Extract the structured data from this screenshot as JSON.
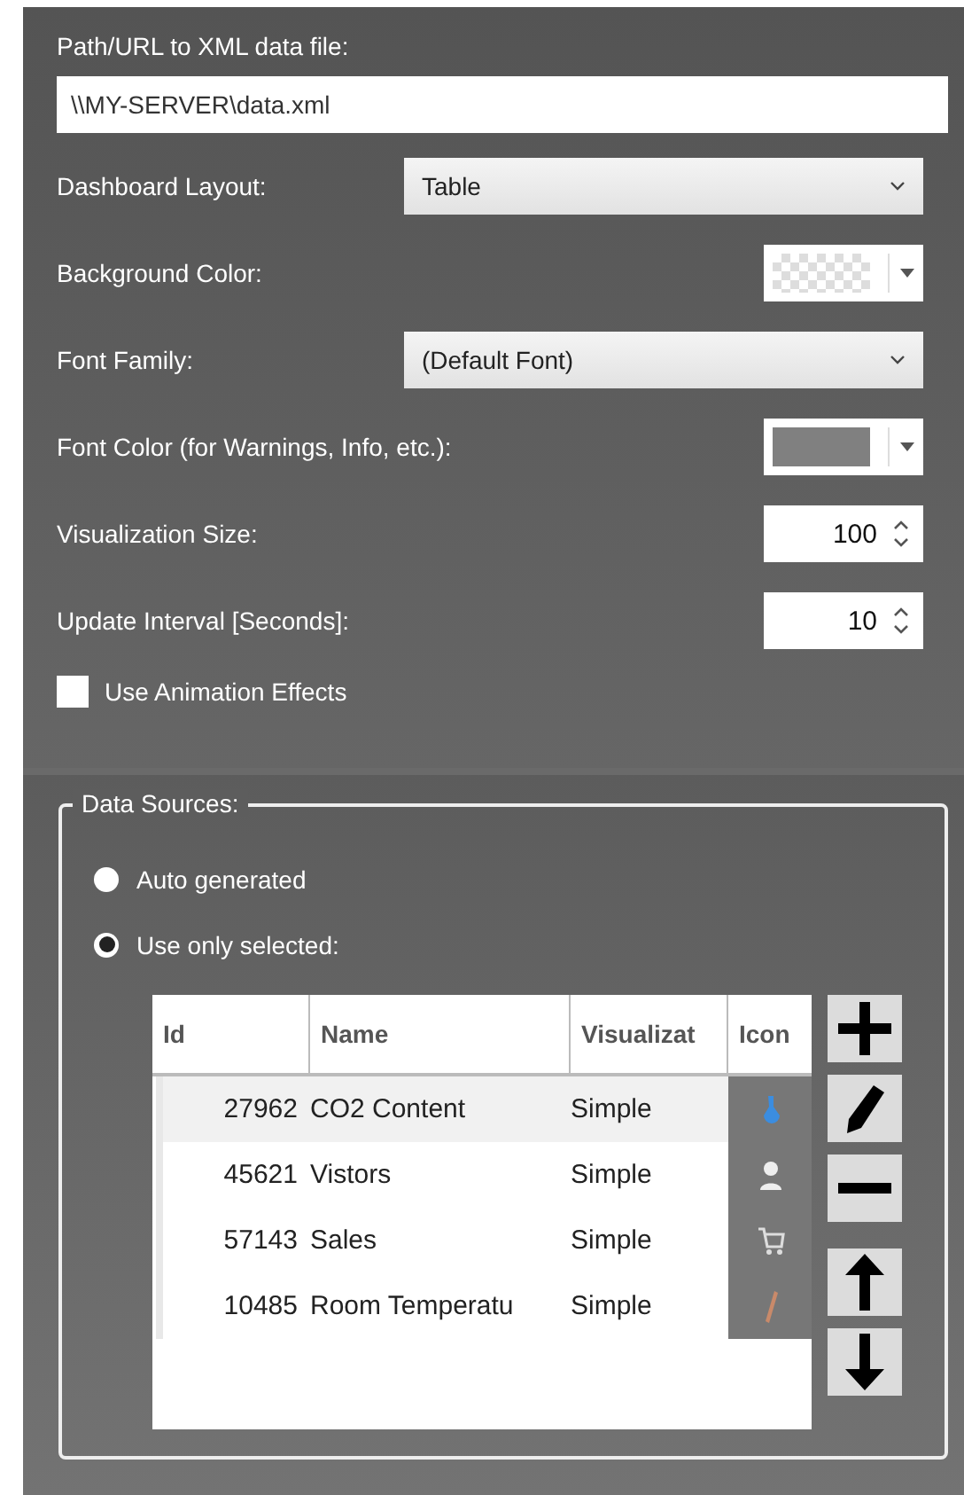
{
  "path_field": {
    "label": "Path/URL to XML data file:",
    "value": "\\\\MY-SERVER\\data.xml"
  },
  "settings": [
    {
      "kind": "dropdown",
      "label": "Dashboard Layout:",
      "value": "Table"
    },
    {
      "kind": "transparent-color",
      "label": "Background Color:"
    },
    {
      "kind": "dropdown",
      "label": "Font Family:",
      "value": "(Default Font)"
    },
    {
      "kind": "color",
      "label": "Font Color (for Warnings, Info, etc.):",
      "color": "#808080"
    },
    {
      "kind": "spinner",
      "label": "Visualization Size:",
      "value": "100"
    },
    {
      "kind": "spinner",
      "label": "Update Interval [Seconds]:",
      "value": "10"
    }
  ],
  "animation_checkbox": {
    "label": "Use Animation Effects",
    "checked": false
  },
  "data_sources": {
    "title": "Data Sources:",
    "options": [
      {
        "label": "Auto generated",
        "selected": false
      },
      {
        "label": "Use only selected:",
        "selected": true
      }
    ],
    "table": {
      "columns": [
        "Id",
        "Name",
        "Visualizat",
        "Icon"
      ],
      "rows": [
        {
          "id": "27962",
          "name": "CO2 Content",
          "visualization": "Simple",
          "selected": true
        },
        {
          "id": "45621",
          "name": "Vistors",
          "visualization": "Simple",
          "selected": false
        },
        {
          "id": "57143",
          "name": "Sales",
          "visualization": "Simple",
          "selected": false
        },
        {
          "id": "10485",
          "name": "Room Temperatu",
          "visualization": "Simple",
          "selected": false
        }
      ]
    }
  }
}
